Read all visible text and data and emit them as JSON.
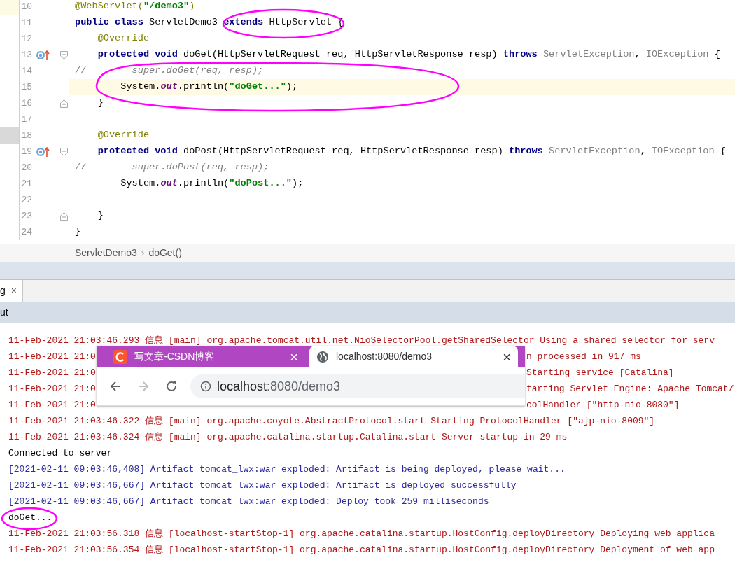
{
  "editor": {
    "lines": [
      {
        "number": "10",
        "highlighted": false,
        "kind": "code",
        "tokens": [
          {
            "text": "@WebServlet(",
            "kind": "annotation"
          },
          {
            "text": "\"/demo3\"",
            "kind": "string"
          },
          {
            "text": ")",
            "kind": "annotation"
          }
        ]
      },
      {
        "number": "11",
        "highlighted": false,
        "kind": "code",
        "tokens": [
          {
            "text": "public class ",
            "kind": "keyword"
          },
          {
            "text": "ServletDemo3 ",
            "kind": "plain"
          },
          {
            "text": "extends ",
            "kind": "keyword"
          },
          {
            "text": "HttpServlet {",
            "kind": "plain"
          }
        ]
      },
      {
        "number": "12",
        "highlighted": false,
        "kind": "code",
        "tokens": [
          {
            "text": "    @Override",
            "kind": "annotation"
          }
        ]
      },
      {
        "number": "13",
        "highlighted": false,
        "kind": "method_header",
        "tokens": [
          {
            "text": "    protected void ",
            "kind": "keyword"
          },
          {
            "text": "doGet(HttpServletRequest req, HttpServletResponse resp) ",
            "kind": "plain"
          },
          {
            "text": "throws ",
            "kind": "keyword"
          },
          {
            "text": "ServletException",
            "kind": "unused"
          },
          {
            "text": ", ",
            "kind": "plain"
          },
          {
            "text": "IOException",
            "kind": "unused"
          },
          {
            "text": " {",
            "kind": "plain"
          }
        ]
      },
      {
        "number": "14",
        "highlighted": false,
        "kind": "code",
        "tokens": [
          {
            "text": "//",
            "kind": "comment_mark"
          },
          {
            "text": "        super.doGet(req, resp);",
            "kind": "comment"
          }
        ]
      },
      {
        "number": "15",
        "highlighted": true,
        "kind": "code",
        "tokens": [
          {
            "text": "        System.",
            "kind": "plain"
          },
          {
            "text": "out",
            "kind": "field"
          },
          {
            "text": ".println(",
            "kind": "plain"
          },
          {
            "text": "\"doGet...\"",
            "kind": "string"
          },
          {
            "text": ");",
            "kind": "plain"
          }
        ]
      },
      {
        "number": "16",
        "highlighted": false,
        "kind": "block_end",
        "tokens": [
          {
            "text": "    }",
            "kind": "plain"
          }
        ]
      },
      {
        "number": "17",
        "highlighted": false,
        "kind": "code"
      },
      {
        "number": "18",
        "highlighted": false,
        "kind": "code",
        "tokens": [
          {
            "text": "    @Override",
            "kind": "annotation"
          }
        ]
      },
      {
        "number": "19",
        "highlighted": false,
        "kind": "method_header",
        "tokens": [
          {
            "text": "    protected void ",
            "kind": "keyword"
          },
          {
            "text": "doPost(HttpServletRequest req, HttpServletResponse resp) ",
            "kind": "plain"
          },
          {
            "text": "throws ",
            "kind": "keyword"
          },
          {
            "text": "ServletException",
            "kind": "unused"
          },
          {
            "text": ", ",
            "kind": "plain"
          },
          {
            "text": "IOException",
            "kind": "unused"
          },
          {
            "text": " {",
            "kind": "plain"
          }
        ]
      },
      {
        "number": "20",
        "highlighted": false,
        "kind": "code",
        "tokens": [
          {
            "text": "//",
            "kind": "comment_mark"
          },
          {
            "text": "        super.doPost(req, resp);",
            "kind": "comment"
          }
        ]
      },
      {
        "number": "21",
        "highlighted": false,
        "kind": "code",
        "tokens": [
          {
            "text": "        System.",
            "kind": "plain"
          },
          {
            "text": "out",
            "kind": "field"
          },
          {
            "text": ".println(",
            "kind": "plain"
          },
          {
            "text": "\"doPost...\"",
            "kind": "string"
          },
          {
            "text": ");",
            "kind": "plain"
          }
        ]
      },
      {
        "number": "22",
        "highlighted": false,
        "kind": "code"
      },
      {
        "number": "23",
        "highlighted": false,
        "kind": "block_end",
        "tokens": [
          {
            "text": "    }",
            "kind": "plain"
          }
        ]
      },
      {
        "number": "24",
        "highlighted": false,
        "kind": "code",
        "tokens": [
          {
            "text": "}",
            "kind": "plain"
          }
        ]
      }
    ]
  },
  "breadcrumb": {
    "items": [
      "ServletDemo3",
      "doGet()"
    ],
    "separator": "›"
  },
  "run_panel": {
    "tab": {
      "label": "g",
      "close": "×"
    },
    "header": "ut",
    "console": [
      {
        "kind": "stderr",
        "text": "11-Feb-2021 21:03:46.293 信息 [main] org.apache.tomcat.util.net.NioSelectorPool.getSharedSelector Using a shared selector for serv"
      },
      {
        "kind": "stderr",
        "text": "11-Feb-2021 21:0",
        "text_right": "n processed in 917 ms"
      },
      {
        "kind": "stderr",
        "text": "11-Feb-2021 21:0",
        "text_right": "Starting service [Catalina]"
      },
      {
        "kind": "stderr",
        "text": "11-Feb-2021 21:0",
        "text_right": "tarting Servlet Engine: Apache Tomcat/"
      },
      {
        "kind": "stderr",
        "text": "11-Feb-2021 21:0",
        "text_right": "colHandler [\"http-nio-8080\"]"
      },
      {
        "kind": "stderr",
        "text": "11-Feb-2021 21:03:46.322 信息 [main] org.apache.coyote.AbstractProtocol.start Starting ProtocolHandler [\"ajp-nio-8009\"]"
      },
      {
        "kind": "stderr",
        "text": "11-Feb-2021 21:03:46.324 信息 [main] org.apache.catalina.startup.Catalina.start Server startup in 29 ms"
      },
      {
        "kind": "stdout",
        "text": "Connected to server"
      },
      {
        "kind": "system",
        "text": "[2021-02-11 09:03:46,408] Artifact tomcat_lwx:war exploded: Artifact is being deployed, please wait..."
      },
      {
        "kind": "system",
        "text": "[2021-02-11 09:03:46,667] Artifact tomcat_lwx:war exploded: Artifact is deployed successfully"
      },
      {
        "kind": "system",
        "text": "[2021-02-11 09:03:46,667] Artifact tomcat_lwx:war exploded: Deploy took 259 milliseconds"
      },
      {
        "kind": "stdout",
        "text": "doGet..."
      },
      {
        "kind": "stderr",
        "text": "11-Feb-2021 21:03:56.318 信息 [localhost-startStop-1] org.apache.catalina.startup.HostConfig.deployDirectory Deploying web applica"
      },
      {
        "kind": "stderr",
        "text": "11-Feb-2021 21:03:56.354 信息 [localhost-startStop-1] org.apache.catalina.startup.HostConfig.deployDirectory Deployment of web app"
      }
    ]
  },
  "browser": {
    "tabs": [
      {
        "title": "写文章-CSDN博客",
        "close": "×",
        "selected": false
      },
      {
        "title": "localhost:8080/demo3",
        "close": "×",
        "selected": true
      }
    ],
    "address": {
      "host": "localhost",
      "path": ":8080/demo3"
    }
  }
}
